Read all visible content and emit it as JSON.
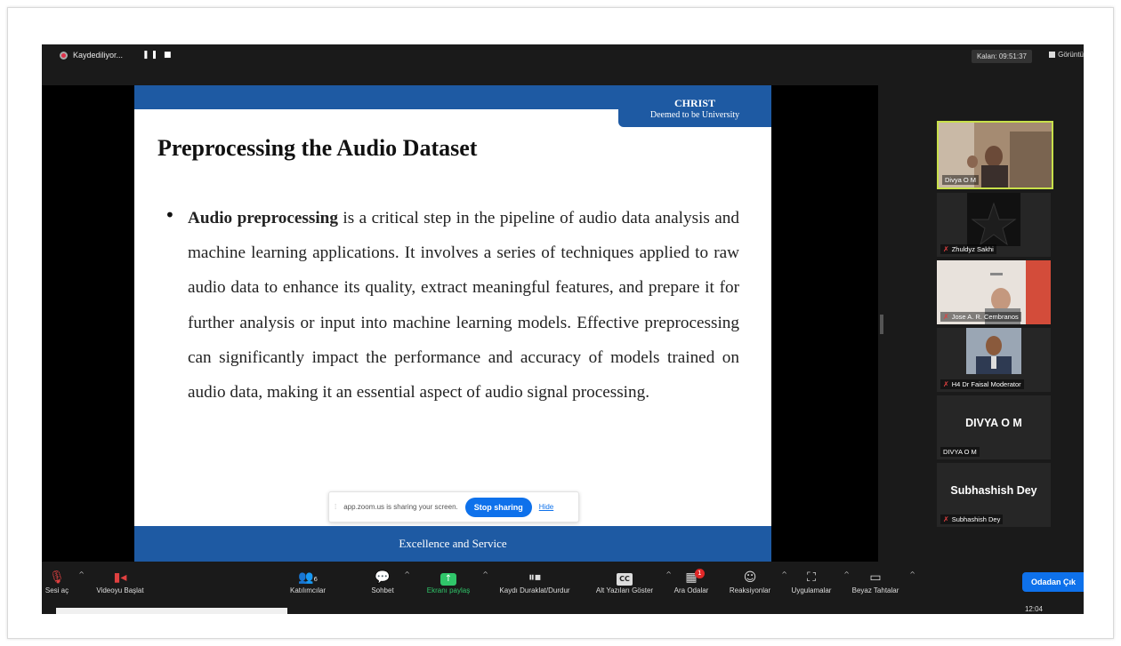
{
  "recording": {
    "status": "Kaydediliyor...",
    "controls": "❚❚ ■"
  },
  "header": {
    "remaining": "Kalan: 09:51:37",
    "view": "Görüntü"
  },
  "slide": {
    "brand_line1": "CHRIST",
    "brand_line2": "Deemed to be University",
    "title": "Preprocessing the Audio Dataset",
    "bullet_bold": "Audio preprocessing",
    "bullet_text": " is a critical step in the pipeline of audio data analysis and machine learning applications. It involves a series of techniques applied to raw audio data to enhance its quality, extract meaningful features, and prepare it for further analysis or input into machine learning models. Effective preprocessing can significantly impact the performance and accuracy of models trained on audio data, making it an essential aspect of audio signal processing.",
    "footer": "Excellence and Service"
  },
  "share_bar": {
    "message": "app.zoom.us is sharing your screen.",
    "stop_label": "Stop sharing",
    "hide_label": "Hide"
  },
  "participants": [
    {
      "name": "Divya O M"
    },
    {
      "name": "Zhuldyz Sakhi"
    },
    {
      "name": "Jose A. R. Cembranos"
    },
    {
      "name": "H4 Dr Faisal Moderator"
    },
    {
      "name": "DIVYA O M",
      "big_name": "DIVYA O M"
    },
    {
      "name": "Subhashish Dey",
      "big_name": "Subhashish Dey"
    }
  ],
  "toolbar": {
    "audio": "Sesi aç",
    "video": "Videoyu Başlat",
    "participants": "Katılımcılar",
    "participants_count": "6",
    "chat": "Sohbet",
    "share": "Ekranı paylaş",
    "record": "Kaydı Duraklat/Durdur",
    "captions": "Alt Yazıları Göster",
    "captions_icon": "CC",
    "breakout": "Ara Odalar",
    "breakout_badge": "1",
    "reactions": "Reaksiyonlar",
    "apps": "Uygulamalar",
    "whiteboard": "Beyaz Tahtalar",
    "leave": "Odadan Çık"
  },
  "system": {
    "time": "12:04"
  },
  "icons": [
    "record-dot-icon",
    "mic-muted-icon",
    "video-off-icon",
    "participants-icon",
    "chat-icon",
    "share-screen-icon",
    "pause-record-icon",
    "cc-icon",
    "breakout-rooms-icon",
    "reactions-icon",
    "apps-icon",
    "whiteboard-icon",
    "view-icon",
    "cursor-icon"
  ],
  "colors": {
    "accent": "#0e71eb",
    "slide_blue": "#1e5aa3",
    "active_speaker": "#c8e04a",
    "share_green": "#30c66a",
    "rec_red": "#e0304a"
  }
}
